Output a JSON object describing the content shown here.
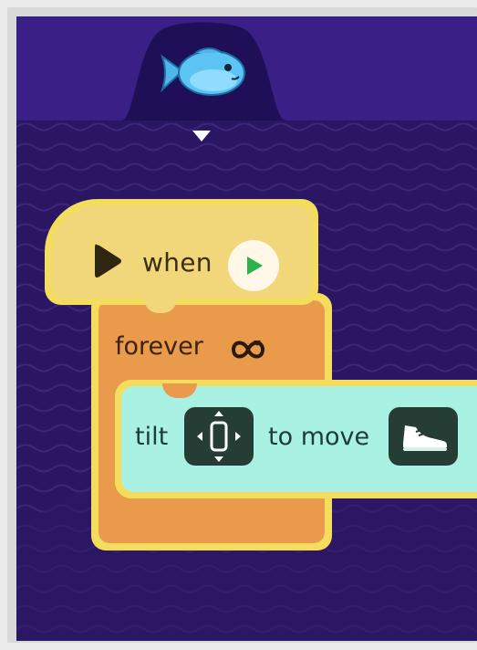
{
  "theme": {
    "stage_bg": "#2a1663",
    "hat_block": "#f2d67a",
    "forever_block": "#e99a4b",
    "action_block": "#a9f2e3",
    "tile_bg": "#263d35",
    "highlight_outline": "#f4dc5c"
  },
  "sprite_tab": {
    "icon": "fish-icon",
    "dropdown_icon": "triangle-down-icon"
  },
  "when_block": {
    "label": "when",
    "leading_icon": "play-icon",
    "trigger_icon": "green-flag-play-icon"
  },
  "forever_block": {
    "label": "forever",
    "icon": "loop-icon"
  },
  "tilt_block": {
    "label_before": "tilt",
    "tilt_icon": "phone-tilt-icon",
    "label_after": "to move",
    "move_icon": "shoe-icon"
  }
}
